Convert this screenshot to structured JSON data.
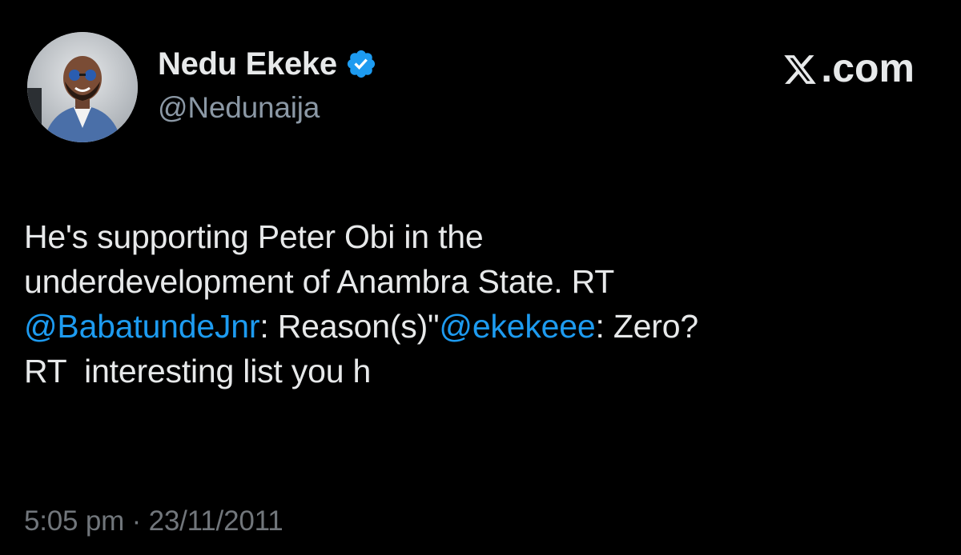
{
  "tweet": {
    "author": {
      "display_name": "Nedu Ekeke",
      "handle": "@Nedunaija",
      "verified": true,
      "avatar_icon": "profile-photo"
    },
    "brand": {
      "label": ".com",
      "logo_icon": "x-logo-icon"
    },
    "text": {
      "line1": "He's supporting Peter Obi in the",
      "line2": "underdevelopment of Anambra State. RT",
      "mention1": "@BabatundeJnr",
      "segment3a": ": Reason(s)\"",
      "mention2": "@ekekeee",
      "segment3b": ": Zero?",
      "line4": "RT  interesting list you h"
    },
    "timestamp": "5:05 pm · 23/11/2011"
  },
  "colors": {
    "background": "#000000",
    "text_primary": "#e7e9ea",
    "text_secondary": "#71767b",
    "mention": "#1d9bf0",
    "verified_badge": "#1d9bf0"
  }
}
